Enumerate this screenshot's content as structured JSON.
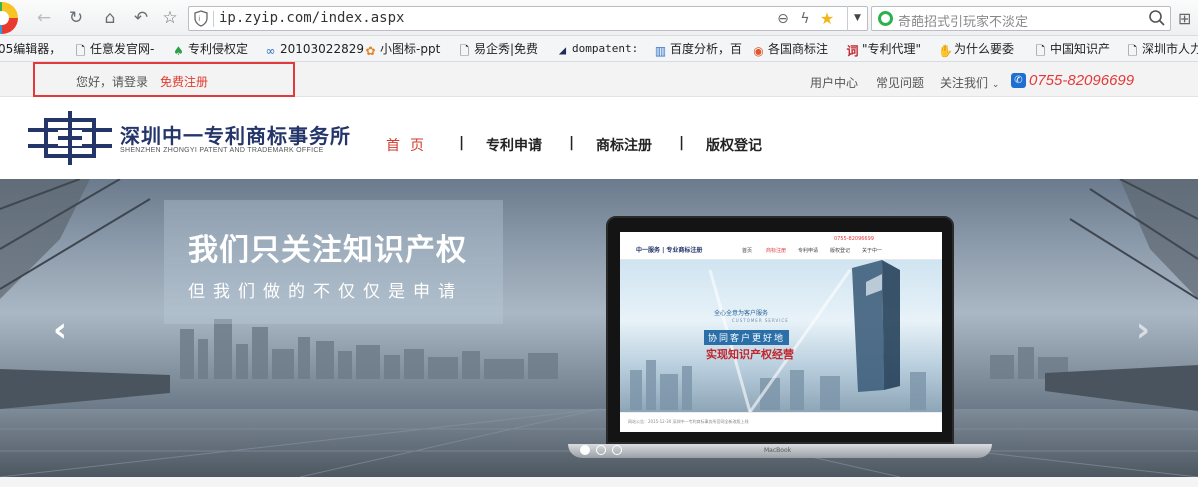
{
  "browser": {
    "url": "ip.zyip.com/index.aspx",
    "search_placeholder": "奇葩招式引玩家不淡定",
    "bookmarks": [
      {
        "label": "05编辑器，",
        "icon": "doc-icon"
      },
      {
        "label": "任意发官网-",
        "icon": "doc-icon"
      },
      {
        "label": "专利侵权定",
        "icon": "leaf-icon"
      },
      {
        "label": "20103022829",
        "icon": "link-icon"
      },
      {
        "label": "小图标-ppt",
        "icon": "flower-icon"
      },
      {
        "label": "易企秀|免费",
        "icon": "doc-icon"
      },
      {
        "label": "dompatent:",
        "icon": "triangle-icon"
      },
      {
        "label": "百度分析，百",
        "icon": "chart-icon"
      },
      {
        "label": "各国商标注",
        "icon": "shop-icon"
      },
      {
        "label": "\"专利代理\"",
        "icon": "ci-icon"
      },
      {
        "label": "为什么要委",
        "icon": "hand-icon"
      },
      {
        "label": "中国知识产",
        "icon": "doc-icon"
      },
      {
        "label": "深圳市人力",
        "icon": "doc-icon"
      }
    ]
  },
  "topbar": {
    "greeting": "您好，请登录",
    "register": "免费注册",
    "user_center": "用户中心",
    "faq": "常见问题",
    "follow_us": "关注我们",
    "phone": "0755-82096699"
  },
  "header": {
    "logo_title": "深圳中一专利商标事务所",
    "logo_subtitle": "SHENZHEN ZHONGYI PATENT AND TRADEMARK OFFICE",
    "nav": [
      "首页",
      "专利申请",
      "商标注册",
      "版权登记"
    ],
    "separator": "|"
  },
  "banner": {
    "title": "我们只关注知识产权",
    "subtitle": "但我们做的不仅仅是申请",
    "laptop": {
      "phone": "0755-82096699",
      "logo": "中一服务 | 专业商标注册",
      "nav": [
        "首页",
        "商标注册",
        "专利申请",
        "版权登记",
        "关于中一"
      ],
      "badge": "全心全意为客户服务",
      "badge_en": "CUSTOMER SERVICE",
      "line1": "协同客户更好地",
      "line2": "实现知识产权经营",
      "footer": "网站公告：2015-12-30 深圳中一专利商标事务所官网全新改版上线",
      "brand": "MacBook"
    }
  },
  "colors": {
    "accent_red": "#e23a3a",
    "brand_navy": "#24356a",
    "phone_blue": "#1f6fd1"
  }
}
